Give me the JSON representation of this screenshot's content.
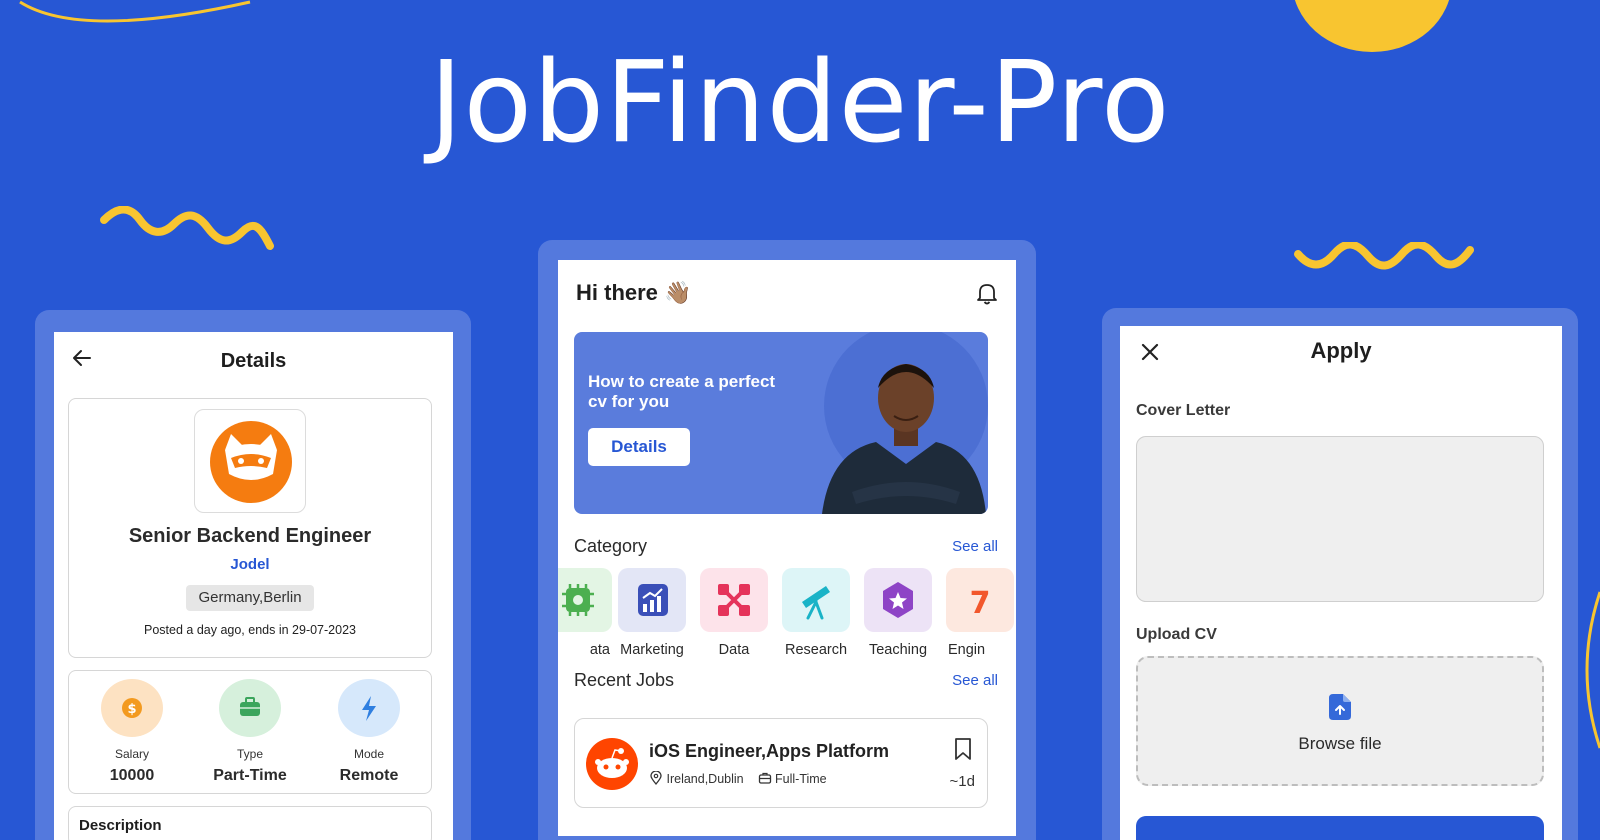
{
  "app_title": "JobFinder-Pro",
  "colors": {
    "background": "#2757D4",
    "accent_yellow": "#F8C530",
    "frame": "#5479DD",
    "primary": "#2757D4"
  },
  "details_screen": {
    "title": "Details",
    "back_icon": "arrow-left-icon",
    "company_logo_icon": "fox-logo-icon",
    "job_title": "Senior Backend Engineer",
    "company": "Jodel",
    "location": "Germany,Berlin",
    "posted": "Posted a day ago, ends in 29-07-2023",
    "stats": [
      {
        "label": "Salary",
        "value": "10000",
        "icon": "dollar-coin-icon",
        "color": "#FDE2C2"
      },
      {
        "label": "Type",
        "value": "Part-Time",
        "icon": "briefcase-icon",
        "color": "#D6F0DC"
      },
      {
        "label": "Mode",
        "value": "Remote",
        "icon": "lightning-icon",
        "color": "#D6E8FB"
      }
    ],
    "description_heading": "Description"
  },
  "home_screen": {
    "greeting": "Hi there 👋🏽",
    "bell_icon": "bell-icon",
    "banner": {
      "text": "How to create a perfect cv for you",
      "button_label": "Details"
    },
    "category_heading": "Category",
    "category_see_all": "See all",
    "categories": [
      {
        "label": "ata",
        "icon": "chip-icon",
        "color": "#E3F5E4"
      },
      {
        "label": "Marketing",
        "icon": "chart-icon",
        "color": "#E3E6F6"
      },
      {
        "label": "Data",
        "icon": "nodes-icon",
        "color": "#FDE3EA"
      },
      {
        "label": "Research",
        "icon": "telescope-icon",
        "color": "#DDF5F7"
      },
      {
        "label": "Teaching",
        "icon": "hexagon-star-icon",
        "color": "#EDE3F6"
      },
      {
        "label": "Engin",
        "icon": "engineering-icon",
        "color": "#FDE8DF"
      }
    ],
    "recent_heading": "Recent Jobs",
    "recent_see_all": "See all",
    "recent_job": {
      "title": "iOS Engineer,Apps Platform",
      "location": "Ireland,Dublin",
      "type": "Full-Time",
      "age": "~1d",
      "logo_icon": "reddit-logo-icon",
      "bookmark_icon": "bookmark-icon"
    }
  },
  "apply_screen": {
    "title": "Apply",
    "close_icon": "close-icon",
    "cover_letter_label": "Cover Letter",
    "upload_label": "Upload CV",
    "browse_label": "Browse file",
    "upload_icon": "file-upload-icon"
  }
}
